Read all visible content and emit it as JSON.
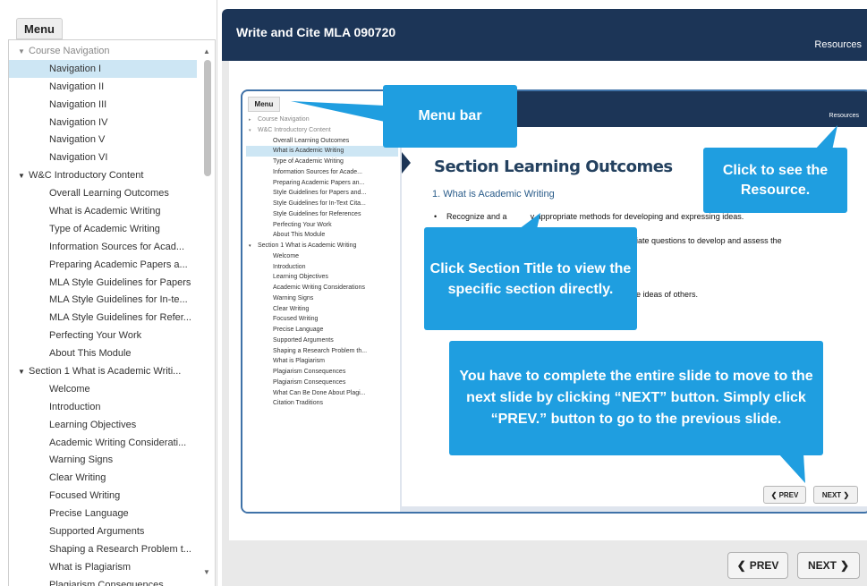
{
  "menu": {
    "title": "Menu",
    "items": [
      {
        "type": "section",
        "label": "Course Navigation",
        "muted": true
      },
      {
        "type": "sub",
        "label": "Navigation I",
        "active": true
      },
      {
        "type": "sub",
        "label": "Navigation II"
      },
      {
        "type": "sub",
        "label": "Navigation III"
      },
      {
        "type": "sub",
        "label": "Navigation IV"
      },
      {
        "type": "sub",
        "label": "Navigation V"
      },
      {
        "type": "sub",
        "label": "Navigation VI"
      },
      {
        "type": "section",
        "label": "W&C Introductory Content"
      },
      {
        "type": "sub",
        "label": "Overall Learning Outcomes"
      },
      {
        "type": "sub",
        "label": "What is Academic Writing"
      },
      {
        "type": "sub",
        "label": "Type of Academic Writing"
      },
      {
        "type": "sub",
        "label": "Information Sources for Acad..."
      },
      {
        "type": "sub",
        "label": "Preparing Academic Papers a..."
      },
      {
        "type": "sub",
        "label": "MLA Style Guidelines for Papers"
      },
      {
        "type": "sub",
        "label": "MLA Style Guidelines for In-te..."
      },
      {
        "type": "sub",
        "label": "MLA Style Guidelines for Refer..."
      },
      {
        "type": "sub",
        "label": "Perfecting Your Work"
      },
      {
        "type": "sub",
        "label": "About This Module"
      },
      {
        "type": "section",
        "label": "Section 1 What is Academic Writi..."
      },
      {
        "type": "sub",
        "label": "Welcome"
      },
      {
        "type": "sub",
        "label": "Introduction"
      },
      {
        "type": "sub",
        "label": "Learning Objectives"
      },
      {
        "type": "sub",
        "label": "Academic Writing Considerati..."
      },
      {
        "type": "sub",
        "label": "Warning Signs"
      },
      {
        "type": "sub",
        "label": "Clear Writing"
      },
      {
        "type": "sub",
        "label": "Focused Writing"
      },
      {
        "type": "sub",
        "label": "Precise Language"
      },
      {
        "type": "sub",
        "label": "Supported Arguments"
      },
      {
        "type": "sub",
        "label": "Shaping a Research Problem t..."
      },
      {
        "type": "sub",
        "label": "What is Plagiarism"
      },
      {
        "type": "sub",
        "label": "Plagiarism Consequences"
      }
    ]
  },
  "header": {
    "title": "Write and Cite MLA 090720",
    "resources": "Resources"
  },
  "screenshot": {
    "menu_title": "Menu",
    "resources": "Resources",
    "items": [
      {
        "type": "section",
        "label": "Course Navigation",
        "muted": true,
        "tri": "▸"
      },
      {
        "type": "section",
        "label": "W&C Introductory Content",
        "muted": true,
        "tri": "▾"
      },
      {
        "type": "sub",
        "label": "Overall Learning Outcomes"
      },
      {
        "type": "sub",
        "label": "What is Academic Writing",
        "active": true
      },
      {
        "type": "sub",
        "label": "Type of Academic Writing"
      },
      {
        "type": "sub",
        "label": "Information Sources for Acade..."
      },
      {
        "type": "sub",
        "label": "Preparing Academic Papers an..."
      },
      {
        "type": "sub",
        "label": "Style Guidelines for Papers and..."
      },
      {
        "type": "sub",
        "label": "Style Guidelines for In-Text Cita..."
      },
      {
        "type": "sub",
        "label": "Style Guidelines for References"
      },
      {
        "type": "sub",
        "label": "Perfecting Your Work"
      },
      {
        "type": "sub",
        "label": "About This Module"
      },
      {
        "type": "section",
        "label": "Section 1 What is Academic Writing",
        "tri": "▾"
      },
      {
        "type": "sub",
        "label": "Welcome"
      },
      {
        "type": "sub",
        "label": "Introduction"
      },
      {
        "type": "sub",
        "label": "Learning Objectives"
      },
      {
        "type": "sub",
        "label": "Academic Writing Considerations"
      },
      {
        "type": "sub",
        "label": "Warning Signs"
      },
      {
        "type": "sub",
        "label": "Clear Writing"
      },
      {
        "type": "sub",
        "label": "Focused Writing"
      },
      {
        "type": "sub",
        "label": "Precise Language"
      },
      {
        "type": "sub",
        "label": "Supported Arguments"
      },
      {
        "type": "sub",
        "label": "Shaping a Research Problem th..."
      },
      {
        "type": "sub",
        "label": "What is Plagiarism"
      },
      {
        "type": "sub",
        "label": "Plagiarism Consequences"
      },
      {
        "type": "sub",
        "label": "Plagiarism Consequences"
      },
      {
        "type": "sub",
        "label": "What Can Be Done About Plagi..."
      },
      {
        "type": "sub",
        "label": "Citation Traditions"
      }
    ],
    "slide_title": "Section Learning Outcomes",
    "slide_sub": "1. What is Academic Writing",
    "bullet1_a": "Recognize and a",
    "bullet1_b": "y appropriate methods for developing and expressing ideas.",
    "bullet2": "ropriate questions to develop and assess the",
    "bullet3": "ing the ideas of others.",
    "prev": "PREV",
    "next": "NEXT"
  },
  "callouts": {
    "menu_bar": "Menu bar",
    "resource": "Click to see the Resource.",
    "section": "Click Section Title to view the specific section directly.",
    "navigation": "You have to complete the entire slide to move to the next slide by clicking “NEXT” button. Simply click “PREV.” button to go to the previous slide."
  },
  "nav": {
    "prev": "PREV",
    "next": "NEXT"
  },
  "colors": {
    "header": "#1c3557",
    "callout": "#1f9ee0",
    "active_item": "#cde6f4"
  }
}
